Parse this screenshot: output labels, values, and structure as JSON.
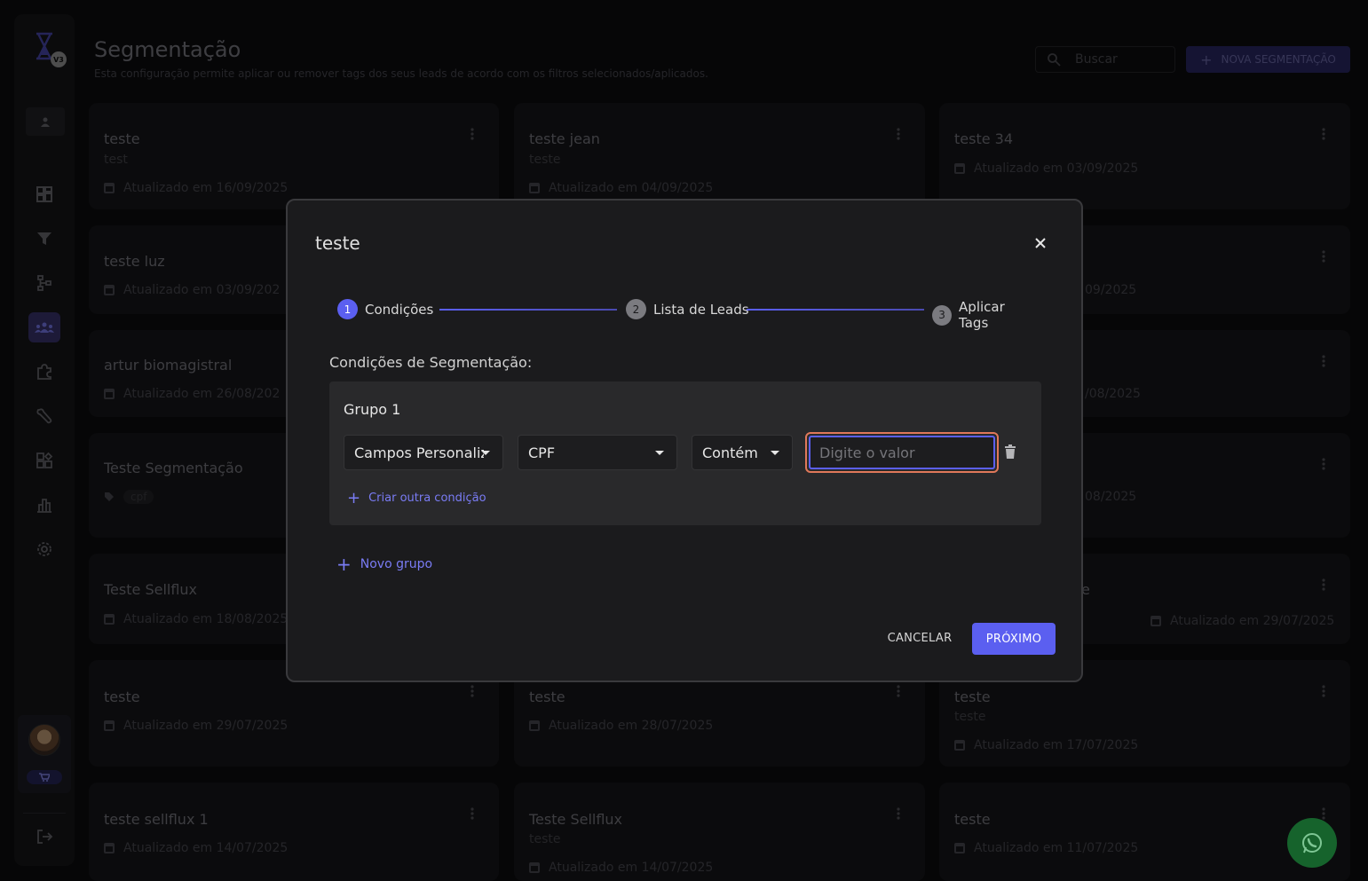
{
  "sidebar": {
    "logo_badge": "V3",
    "nav_icons": [
      "dashboard-icon",
      "filter-icon",
      "flow-icon",
      "segments-icon",
      "puzzle-icon",
      "wrench-icon",
      "apps-icon",
      "chart-icon",
      "settings-icon"
    ],
    "active_index": 3
  },
  "header": {
    "title": "Segmentação",
    "subtitle": "Esta configuração permite aplicar ou remover tags dos seus leads de acordo com os filtros selecionados/aplicados.",
    "search_placeholder": "Buscar",
    "new_button_label": "NOVA SEGMENTAÇÃO"
  },
  "cards": [
    {
      "title": "teste",
      "sub": "test",
      "date": "Atualizado em 16/09/2025"
    },
    {
      "title": "teste jean",
      "sub": "teste",
      "date": "Atualizado em 04/09/2025"
    },
    {
      "title": "teste 34",
      "sub": "",
      "date": "Atualizado em 03/09/2025"
    },
    {
      "title": "teste luz",
      "sub": "",
      "date": "Atualizado em 03/09/202"
    },
    {
      "title": "",
      "sub": "",
      "date": "09/2025"
    },
    {
      "title": "artur biomagistral",
      "sub": "",
      "date": "Atualizado em 26/08/202"
    },
    {
      "title": "",
      "sub": "",
      "date": "/08/2025"
    },
    {
      "title": "Teste Segmentação",
      "tag": "cpf",
      "date": ""
    },
    {
      "title": "",
      "sub": "",
      "date": "08/2025"
    },
    {
      "title": "Teste Sellflux",
      "sub": "",
      "date": "Atualizado em 18/08/2025"
    },
    {
      "title": "e",
      "sub": "",
      "date": "Atualizado em 29/07/2025"
    },
    {
      "title": "teste",
      "sub": "",
      "date": "Atualizado em 29/07/2025"
    },
    {
      "title": "teste",
      "sub": "",
      "date": "Atualizado em 28/07/2025"
    },
    {
      "title": "teste",
      "sub": "teste",
      "date": "Atualizado em 17/07/2025"
    },
    {
      "title": "teste sellflux 1",
      "sub": "",
      "date": "Atualizado em 14/07/2025"
    },
    {
      "title": "Teste Sellflux",
      "sub": "teste",
      "date": "Atualizado em 14/07/2025"
    },
    {
      "title": "teste",
      "sub": "",
      "date": "Atualizado em 11/07/2025"
    }
  ],
  "modal": {
    "title": "teste",
    "steps": [
      {
        "num": "1",
        "label": "Condições"
      },
      {
        "num": "2",
        "label": "Lista de Leads"
      },
      {
        "num": "3",
        "label": "Aplicar Tags"
      }
    ],
    "conditions_title": "Condições de Segmentação:",
    "group_title": "Grupo 1",
    "field_select": "Campos Personaliz",
    "field_name": "CPF",
    "operator": "Contém",
    "value_placeholder": "Digite o valor",
    "add_condition": "Criar outra condição",
    "add_group": "Novo grupo",
    "cancel_label": "CANCELAR",
    "next_label": "PRÓXIMO"
  },
  "colors": {
    "accent": "#5b5ff0",
    "focus_ring": "#e0785a",
    "whatsapp": "#16632c"
  }
}
